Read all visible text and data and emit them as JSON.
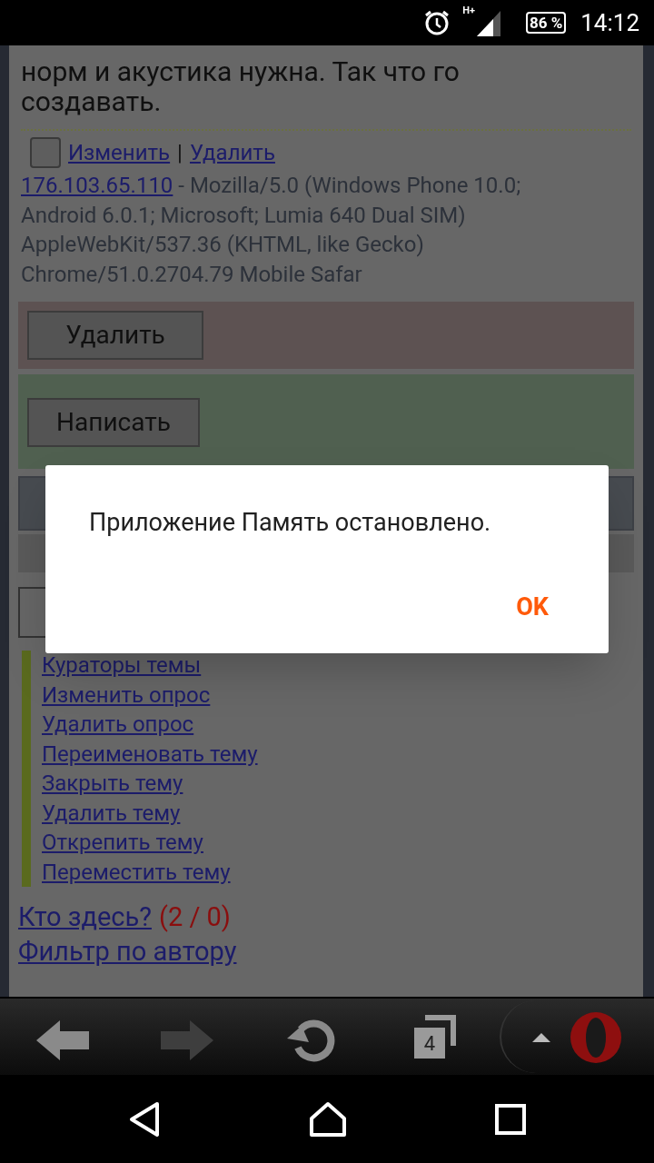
{
  "status_bar": {
    "network": "H+",
    "battery": "86 %",
    "time": "14:12"
  },
  "post": {
    "body": "норм и акустика нужна. Так что го создавать.",
    "checkbox": {
      "checked": false
    },
    "actions": [
      "Изменить",
      "Удалить"
    ],
    "separator": "|",
    "ip": "176.103.65.110",
    "user_agent": "- Mozilla/5.0 (Windows Phone 10.0; Android 6.0.1; Microsoft; Lumia 640 Dual SIM) AppleWebKit/537.36 (KHTML, like Gecko) Chrome/51.0.2704.79 Mobile Safar"
  },
  "delete_button": "Удалить",
  "write_button": "Написать",
  "admin_links": [
    "Кураторы темы",
    "Изменить опрос",
    "Удалить опрос",
    "Переименовать тему",
    "Закрыть тему",
    "Удалить тему",
    "Открепить тему",
    "Переместить тему"
  ],
  "who_here": {
    "link": "Кто здесь?",
    "count": "(2 / 0)"
  },
  "author_filter": "Фильтр по автору",
  "browser_bar": {
    "tabs_count": "4"
  },
  "dialog": {
    "message": "Приложение Память остановлено.",
    "button": "OK"
  }
}
